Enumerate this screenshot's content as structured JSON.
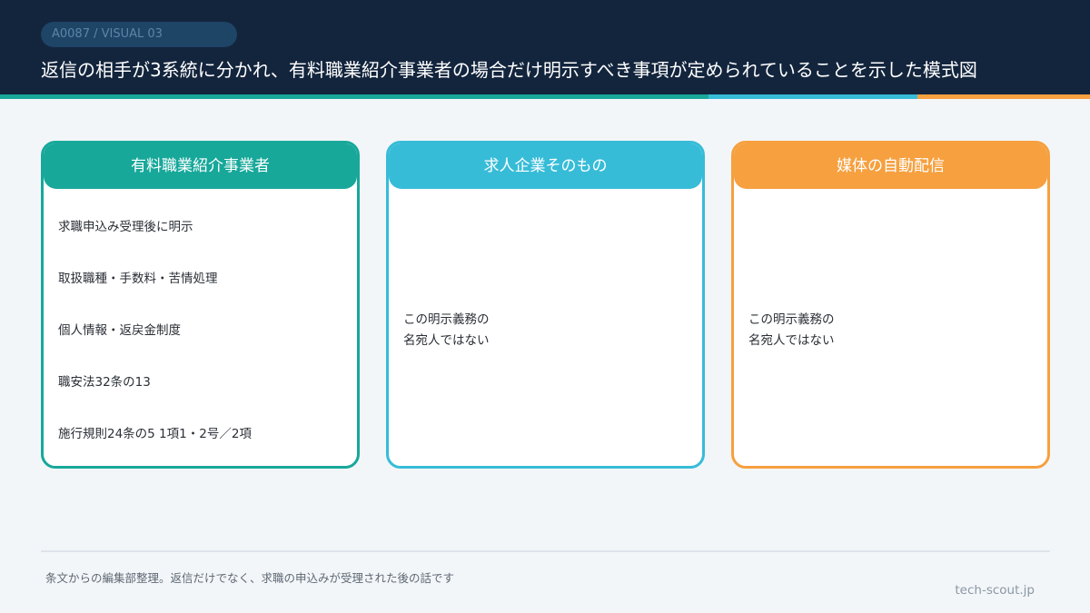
{
  "header": {
    "badge": "A0087 / VISUAL 03",
    "title": "返信の相手が3系統に分かれ、有料職業紹介事業者の場合だけ明示すべき事項が定められていることを示した模式図"
  },
  "colors": {
    "header_bg": "#13253d",
    "teal": "#17a89a",
    "cyan": "#37bcd8",
    "orange": "#f6a03f"
  },
  "cards": [
    {
      "title": "有料職業紹介事業者",
      "items": [
        "求職申込み受理後に明示",
        "取扱職種・手数料・苦情処理",
        "個人情報・返戻金制度",
        "職安法32条の13",
        "施行規則24条の5 1項1・2号／2項"
      ]
    },
    {
      "title": "求人企業そのもの",
      "note_lines": [
        "この明示義務の",
        "名宛人ではない"
      ]
    },
    {
      "title": "媒体の自動配信",
      "note_lines": [
        "この明示義務の",
        "名宛人ではない"
      ]
    }
  ],
  "footer": {
    "note": "条文からの編集部整理。返信だけでなく、求職の申込みが受理された後の話です",
    "site": "tech-scout.jp"
  }
}
